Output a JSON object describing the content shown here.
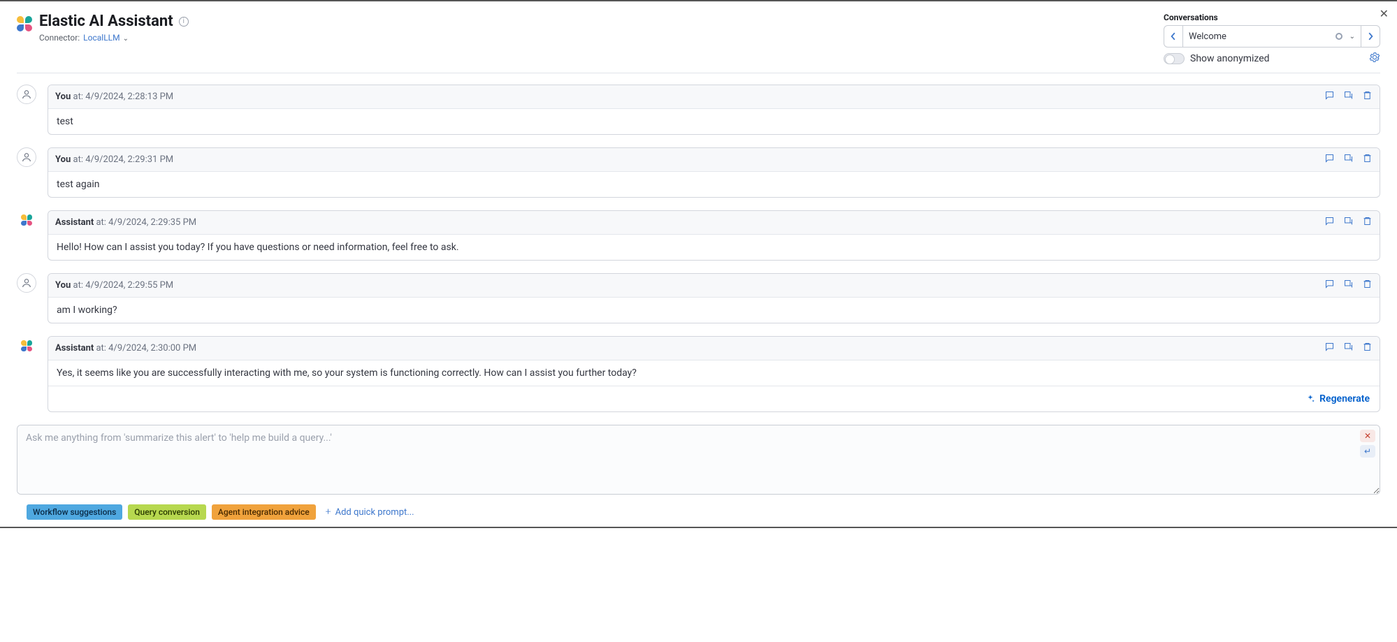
{
  "header": {
    "title": "Elastic AI Assistant",
    "connector_label": "Connector:",
    "connector_name": "LocalLLM"
  },
  "conversations": {
    "label": "Conversations",
    "selected": "Welcome",
    "show_anonymized_label": "Show anonymized"
  },
  "messages": [
    {
      "role": "You",
      "at_label": "at:",
      "timestamp": "4/9/2024, 2:28:13 PM",
      "body": "test"
    },
    {
      "role": "You",
      "at_label": "at:",
      "timestamp": "4/9/2024, 2:29:31 PM",
      "body": "test again"
    },
    {
      "role": "Assistant",
      "at_label": "at:",
      "timestamp": "4/9/2024, 2:29:35 PM",
      "body": "Hello! How can I assist you today? If you have questions or need information, feel free to ask."
    },
    {
      "role": "You",
      "at_label": "at:",
      "timestamp": "4/9/2024, 2:29:55 PM",
      "body": "am I working?"
    },
    {
      "role": "Assistant",
      "at_label": "at:",
      "timestamp": "4/9/2024, 2:30:00 PM",
      "body": "Yes, it seems like you are successfully interacting with me, so your system is functioning correctly. How can I assist you further today?"
    }
  ],
  "regenerate_label": "Regenerate",
  "input": {
    "placeholder": "Ask me anything from 'summarize this alert' to 'help me build a query...'"
  },
  "quick_prompts": {
    "items": [
      "Workflow suggestions",
      "Query conversion",
      "Agent integration advice"
    ],
    "add_label": "Add quick prompt..."
  }
}
